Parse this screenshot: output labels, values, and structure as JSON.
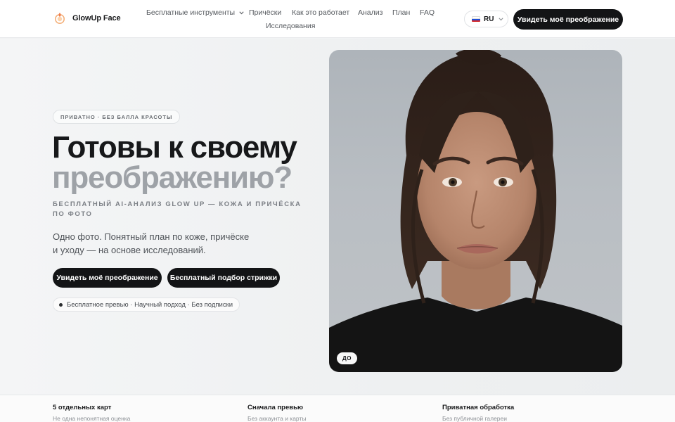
{
  "header": {
    "brand_name": "GlowUp Face",
    "nav": {
      "free_tools": "Бесплатные инструменты",
      "hairstyles": "Причёски",
      "how_it_works": "Как это работает",
      "analysis": "Анализ",
      "plan": "План",
      "faq": "FAQ",
      "research": "Исследования"
    },
    "lang_code": "RU",
    "cta": "Увидеть моё преображение"
  },
  "hero": {
    "badge": "ПРИВАТНО · БЕЗ БАЛЛА КРАСОТЫ",
    "title_line1": "Готовы к своему",
    "title_line2": "преображению?",
    "subtitle": "Бесплатный AI-анализ Glow Up — кожа и причёска по фото",
    "description": "Одно фото. Понятный план по коже, причёске и уходу — на основе исследований.",
    "primary_button": "Увидеть моё преображение",
    "secondary_button": "Бесплатный подбор стрижки",
    "features": "Бесплатное превью · Научный подход · Без подписки",
    "photo_label": "ДО"
  },
  "bottom": [
    {
      "title": "5 отдельных карт",
      "subtitle": "Не одна непонятная оценка"
    },
    {
      "title": "Сначала превью",
      "subtitle": "Без аккаунта и карты"
    },
    {
      "title": "Приватная обработка",
      "subtitle": "Без публичной галереи"
    }
  ],
  "icons": {
    "logo": "glowup-logo-icon",
    "caret": "chevron-down-icon",
    "flag": "russia-flag-icon",
    "dot": "bullet-dot-icon"
  },
  "colors": {
    "primary_dark": "#131416",
    "title_muted": "#9ea2a7",
    "background": "#f1f3f4"
  }
}
